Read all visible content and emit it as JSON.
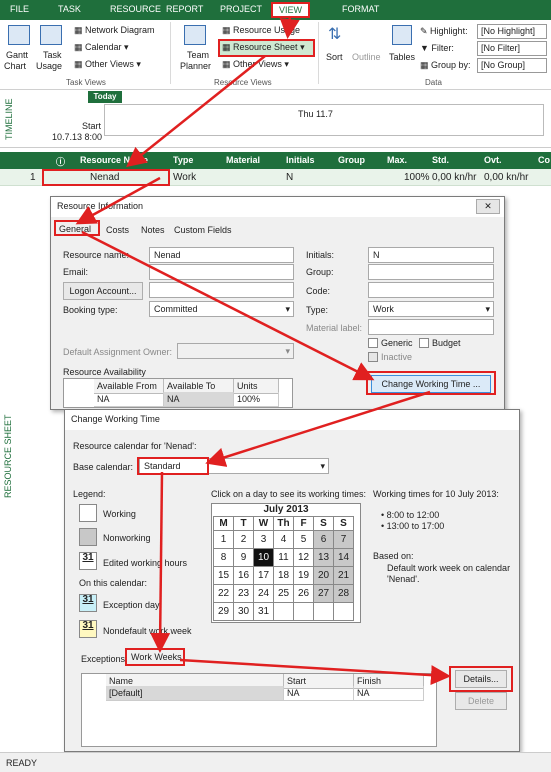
{
  "tabs": {
    "file": "FILE",
    "task": "TASK",
    "resource": "RESOURCE",
    "report": "REPORT",
    "project": "PROJECT",
    "view": "VIEW",
    "format": "FORMAT"
  },
  "ribbon": {
    "gantt": "Gantt",
    "gantt2": "Chart",
    "task_usage": "Task",
    "task_usage2": "Usage",
    "network": "Network Diagram",
    "calendar": "Calendar",
    "other_views": "Other Views",
    "grp_task_views": "Task Views",
    "team_planner": "Team",
    "team_planner2": "Planner",
    "resource_usage": "Resource Usage",
    "resource_sheet": "Resource Sheet",
    "other_views2": "Other Views",
    "grp_resource_views": "Resource Views",
    "sort": "Sort",
    "outline": "Outline",
    "tables": "Tables",
    "highlight": "Highlight:",
    "highlight_val": "[No Highlight]",
    "filter": "Filter:",
    "filter_val": "[No Filter]",
    "group_by": "Group by:",
    "group_by_val": "[No Group]",
    "grp_data": "Data"
  },
  "timeline": {
    "label": "TIMELINE",
    "today": "Today",
    "start": "Start",
    "start_date": "10.7.13 8:00",
    "thu": "Thu 11.7"
  },
  "sheet": {
    "vlabel": "RESOURCE SHEET",
    "headers": [
      "Resource Name",
      "Type",
      "Material",
      "Initials",
      "Group",
      "Max.",
      "Std.",
      "Ovt.",
      "Co"
    ],
    "row": {
      "id": "1",
      "name": "Nenad",
      "type": "Work",
      "initials": "N",
      "max": "100%",
      "std": "0,00 kn/hr",
      "ovt": "0,00 kn/hr"
    }
  },
  "ri": {
    "title": "Resource Information",
    "tabs": [
      "General",
      "Costs",
      "Notes",
      "Custom Fields"
    ],
    "resource_name_lbl": "Resource name:",
    "resource_name": "Nenad",
    "initials_lbl": "Initials:",
    "initials": "N",
    "email_lbl": "Email:",
    "group_lbl": "Group:",
    "logon": "Logon Account...",
    "code_lbl": "Code:",
    "booking_lbl": "Booking type:",
    "booking": "Committed",
    "type_lbl": "Type:",
    "type": "Work",
    "material_lbl": "Material label:",
    "generic": "Generic",
    "budget": "Budget",
    "inactive": "Inactive",
    "default_owner": "Default Assignment Owner:",
    "availability": "Resource Availability",
    "av_headers": [
      "Available From",
      "Available To",
      "Units"
    ],
    "av_row": [
      "NA",
      "NA",
      "100%"
    ],
    "change_wt": "Change Working Time ..."
  },
  "cwt": {
    "title": "Change Working Time",
    "cal_for": "Resource calendar for 'Nenad':",
    "base_lbl": "Base calendar:",
    "base": "Standard",
    "legend": "Legend:",
    "working": "Working",
    "nonworking": "Nonworking",
    "edited": "Edited working hours",
    "on_this": "On this calendar:",
    "exception": "Exception day",
    "nondefault": "Nondefault work week",
    "click_day": "Click on a day to see its working times:",
    "month": "July 2013",
    "weekdays": [
      "M",
      "T",
      "W",
      "Th",
      "F",
      "S",
      "S"
    ],
    "weeks": [
      [
        "1",
        "2",
        "3",
        "4",
        "5",
        "6",
        "7"
      ],
      [
        "8",
        "9",
        "10",
        "11",
        "12",
        "13",
        "14"
      ],
      [
        "15",
        "16",
        "17",
        "18",
        "19",
        "20",
        "21"
      ],
      [
        "22",
        "23",
        "24",
        "25",
        "26",
        "27",
        "28"
      ],
      [
        "29",
        "30",
        "31",
        "",
        "",
        "",
        ""
      ]
    ],
    "wt_for": "Working times for 10 July 2013:",
    "t1": "8:00 to 12:00",
    "t2": "13:00 to 17:00",
    "based_on": "Based on:",
    "default_week": "Default work week on calendar",
    "cal_name": "'Nenad'.",
    "tab_exceptions": "Exceptions",
    "tab_work_weeks": "Work Weeks",
    "ww_headers": [
      "Name",
      "Start",
      "Finish"
    ],
    "ww_row": [
      "[Default]",
      "NA",
      "NA"
    ],
    "details": "Details...",
    "delete": "Delete"
  },
  "status": {
    "ready": "READY"
  }
}
